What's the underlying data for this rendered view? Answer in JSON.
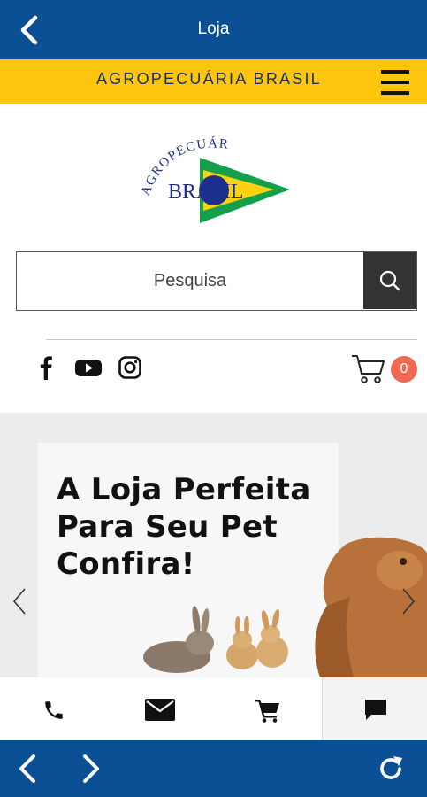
{
  "header": {
    "title": "Loja",
    "back_icon": "chevron-left-icon"
  },
  "brand_bar": {
    "text": "AGROPECUÁRIA BRASIL",
    "menu_icon": "hamburger-menu-icon"
  },
  "logo": {
    "arc_text": "AGROPECUÁRIA",
    "main_text": "BRASIL"
  },
  "search": {
    "placeholder": "Pesquisa",
    "button_icon": "search-icon"
  },
  "social": [
    "facebook-icon",
    "youtube-icon",
    "instagram-icon"
  ],
  "cart": {
    "icon": "cart-icon",
    "count": "0"
  },
  "hero": {
    "headline_line1": "A Loja Perfeita",
    "headline_line2": "Para Seu Pet",
    "headline_line3": "Confira!"
  },
  "actions": [
    "phone-icon",
    "mail-icon",
    "cart-icon",
    "chat-icon"
  ],
  "bottom_nav": [
    "back-arrow-icon",
    "forward-arrow-icon",
    "refresh-icon"
  ],
  "colors": {
    "primary_blue": "#0b4f94",
    "brand_yellow": "#fdc60d",
    "badge": "#ee6a52",
    "logo_green": "#14a04a",
    "logo_navy": "#1d2f8c"
  }
}
